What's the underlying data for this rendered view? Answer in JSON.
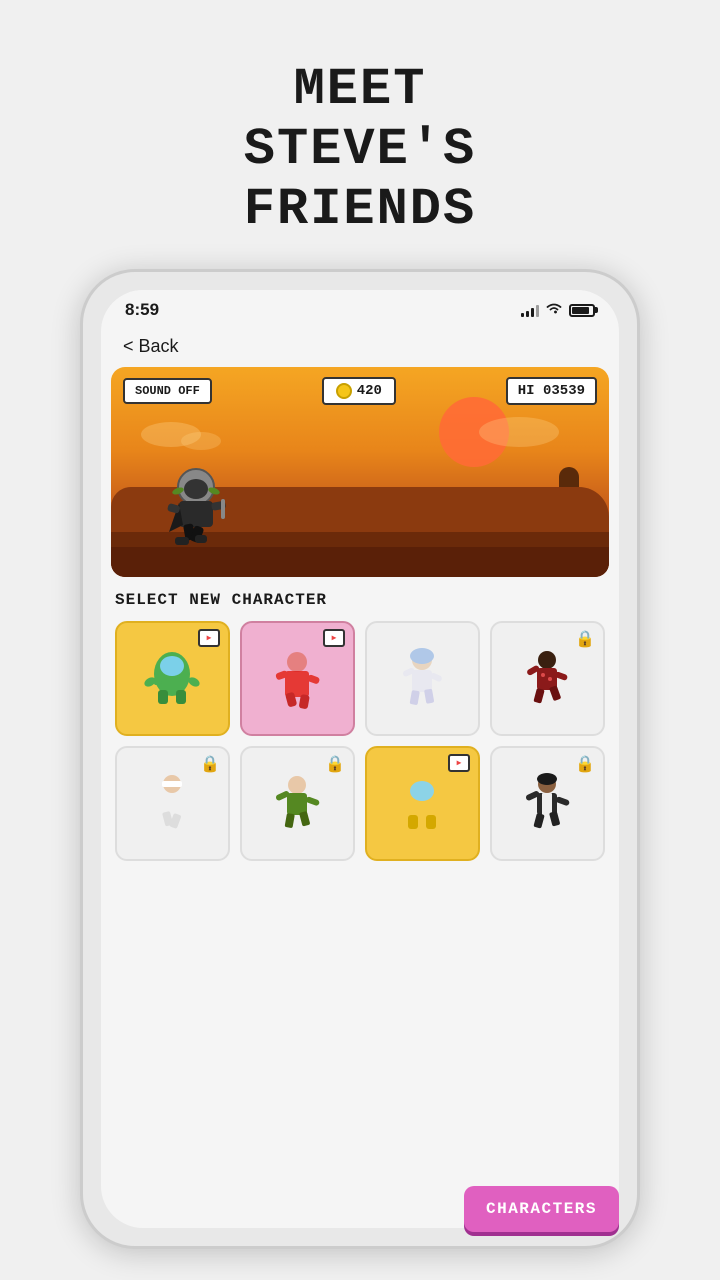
{
  "title": {
    "line1": "MEET",
    "line2": "STEVE'S",
    "line3": "FRIENDS"
  },
  "status_bar": {
    "time": "8:59",
    "signal_bars": [
      4,
      6,
      9,
      12,
      14
    ],
    "wifi": "wifi",
    "battery": 85
  },
  "back_button": "< Back",
  "game_hud": {
    "sound_label": "SOUND OFF",
    "coins": "420",
    "hi_label": "HI  03539"
  },
  "select_section": {
    "title": "SELECT NEW CHARACTER"
  },
  "characters_button": "CHARACTERS",
  "characters": [
    {
      "id": 1,
      "style": "selected-yellow",
      "locked": false,
      "tv": true,
      "name": "among-us-green"
    },
    {
      "id": 2,
      "style": "selected-pink",
      "locked": false,
      "tv": true,
      "name": "squid-game-red"
    },
    {
      "id": 3,
      "style": "unselected",
      "locked": false,
      "tv": false,
      "name": "white-girl"
    },
    {
      "id": 4,
      "style": "locked-card",
      "locked": true,
      "tv": false,
      "name": "running-boy-dark"
    },
    {
      "id": 5,
      "style": "locked-card",
      "locked": true,
      "tv": false,
      "name": "ninja-girl"
    },
    {
      "id": 6,
      "style": "locked-card",
      "locked": true,
      "tv": false,
      "name": "green-ninja"
    },
    {
      "id": 7,
      "style": "selected-yellow",
      "locked": false,
      "tv": true,
      "name": "among-us-yellow"
    },
    {
      "id": 8,
      "style": "locked-card",
      "locked": true,
      "tv": false,
      "name": "dark-suit-guy"
    }
  ]
}
